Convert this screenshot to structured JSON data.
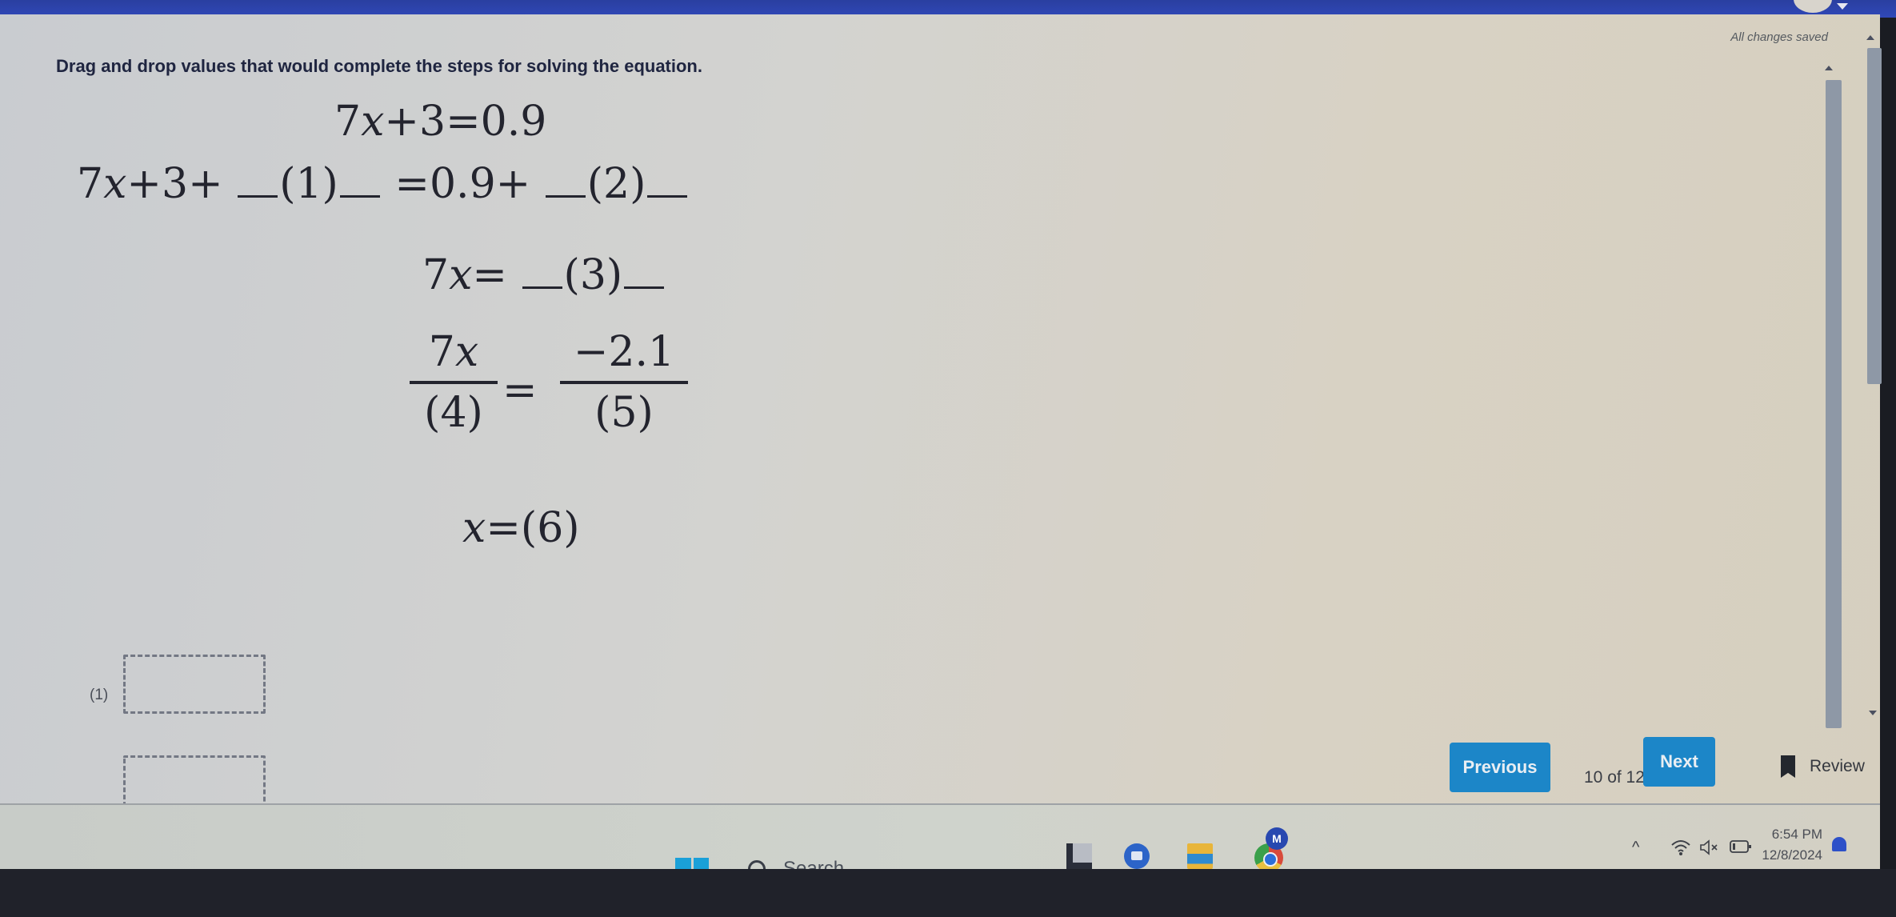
{
  "header": {
    "status": "All changes saved"
  },
  "question": {
    "instructions": "Drag and drop values that would complete the steps for solving the equation.",
    "steps": {
      "line1": {
        "lhs_coef": "7",
        "var": "x",
        "lhs_rest": "+3=0.9"
      },
      "line2": {
        "lhs": "7",
        "var": "x",
        "lhs_rest": "+3+",
        "blank1": "(1)",
        "mid": "=0.9+",
        "blank2": "(2)"
      },
      "line3": {
        "lhs": "7",
        "var": "x",
        "eq": "=",
        "blank3": "(3)"
      },
      "line4": {
        "num_left_coef": "7",
        "num_left_var": "x",
        "den_left": "(4)",
        "eq": "=",
        "num_right": "−2.1",
        "den_right": "(5)"
      },
      "line5": {
        "var": "x",
        "eq": "=",
        "blank6": "(6)"
      }
    },
    "drop_targets": [
      {
        "label": "(1)",
        "value": ""
      },
      {
        "label": "",
        "value": ""
      }
    ]
  },
  "navigation": {
    "previous_label": "Previous",
    "counter": "10 of 12",
    "next_label": "Next",
    "review_label": "Review"
  },
  "taskbar": {
    "search_placeholder": "Search",
    "pinned_apps": [
      "file-explorer",
      "google-meet",
      "files-folder",
      "chrome"
    ],
    "chrome_profile_initial": "M",
    "tray": {
      "show_hidden_glyph": "^",
      "time": "6:54 PM",
      "date": "12/8/2024"
    }
  }
}
